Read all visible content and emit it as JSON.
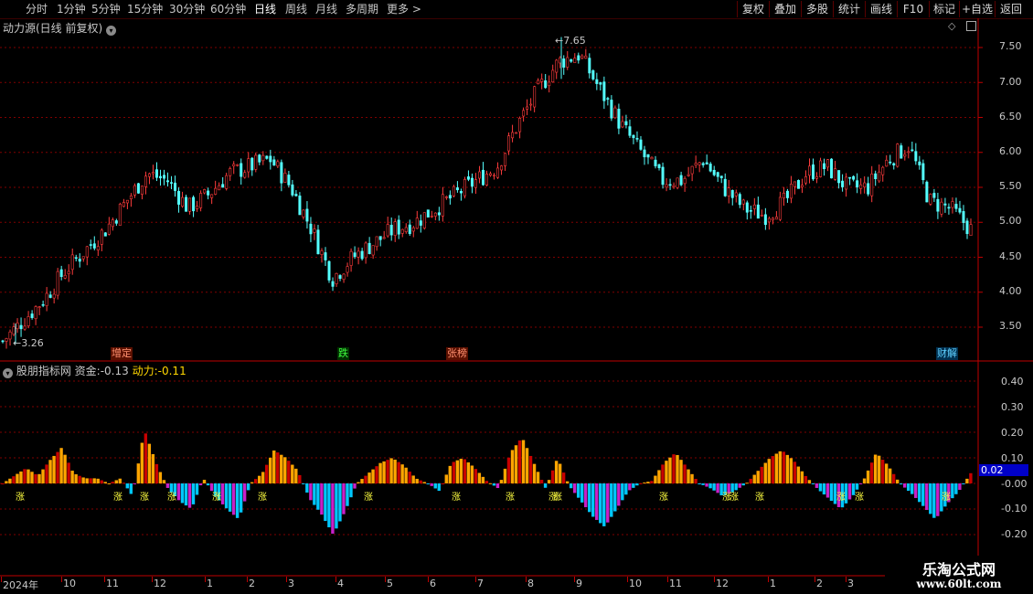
{
  "toolbar": {
    "periods": [
      "分时",
      "1分钟",
      "5分钟",
      "15分钟",
      "30分钟",
      "60分钟",
      "日线",
      "周线",
      "月线",
      "多周期",
      "更多 >"
    ],
    "active_period": "日线",
    "buttons": [
      "复权",
      "叠加",
      "多股",
      "统计",
      "画线",
      "F10",
      "标记",
      "+自选",
      "返回"
    ]
  },
  "main_panel": {
    "title": "动力源(日线 前复权)",
    "high_label": "7.65",
    "low_label": "3.26",
    "y_ticks": [
      "7.50",
      "7.00",
      "6.50",
      "6.00",
      "5.50",
      "5.00",
      "4.50",
      "4.00",
      "3.50"
    ],
    "events": [
      {
        "label": "增定",
        "color": "#ff7060"
      },
      {
        "label": "跌",
        "color": "#40ff40"
      },
      {
        "label": "张榜",
        "color": "#ff7060"
      },
      {
        "label": "财解",
        "color": "#60d0ff"
      }
    ]
  },
  "indicator_panel": {
    "name": "股朋指标网",
    "zijin_label": "资金:",
    "zijin_value": "-0.13",
    "dongli_label": "动力:",
    "dongli_value": "-0.11",
    "y_ticks": [
      "0.40",
      "0.30",
      "0.20",
      "0.10",
      "-0.00",
      "-0.10",
      "-0.20"
    ],
    "current_value_tag": "0.02",
    "signal_label": "涨"
  },
  "time_axis": {
    "labels": [
      "2024年",
      "10",
      "11",
      "12",
      "1",
      "2",
      "3",
      "4",
      "5",
      "6",
      "7",
      "8",
      "9",
      "10",
      "11",
      "12",
      "1",
      "2",
      "3"
    ]
  },
  "watermark": {
    "line1": "乐淘公式网",
    "line2": "www.60lt.com"
  },
  "colors": {
    "up": "#ff3c3c",
    "down": "#54ffff",
    "gridline": "#800000",
    "fund_pos_a": "#ffa500",
    "fund_pos_b": "#c80000",
    "fund_neg_a": "#00c8ff",
    "fund_neg_b": "#c820c8",
    "value_tag_bg": "#0000c8"
  },
  "chart_data": [
    {
      "type": "candlestick",
      "title": "动力源(日线 前复权)",
      "ylim": [
        3.2,
        7.8
      ],
      "y_ticks": [
        3.5,
        4.0,
        4.5,
        5.0,
        5.5,
        6.0,
        6.5,
        7.0,
        7.5
      ],
      "max": 7.65,
      "min": 3.26,
      "close_trend": [
        3.3,
        3.6,
        3.9,
        4.3,
        4.6,
        4.9,
        5.3,
        5.7,
        5.6,
        5.2,
        5.4,
        5.7,
        5.8,
        5.9,
        5.5,
        4.9,
        4.2,
        4.5,
        4.7,
        4.9,
        5.0,
        5.2,
        5.4,
        5.6,
        5.8,
        6.4,
        6.9,
        7.3,
        7.4,
        6.9,
        6.4,
        6.0,
        5.6,
        5.6,
        5.9,
        5.5,
        5.2,
        5.1,
        5.3,
        5.7,
        5.8,
        5.5,
        5.5,
        5.9,
        6.1,
        5.3,
        5.2,
        4.9
      ]
    },
    {
      "type": "bar",
      "title": "股朋指标网",
      "ylim": [
        -0.25,
        0.45
      ],
      "y_ticks": [
        0.4,
        0.3,
        0.2,
        0.1,
        0.0,
        -0.1,
        -0.2
      ],
      "series": [
        {
          "name": "资金",
          "last_value": -0.13
        },
        {
          "name": "动力",
          "last_value": -0.11
        }
      ],
      "values": [
        0.0,
        0.03,
        0.06,
        0.03,
        0.09,
        0.14,
        0.04,
        0.02,
        0.02,
        0.0,
        0.02,
        -0.05,
        0.21,
        0.08,
        -0.02,
        -0.07,
        -0.1,
        0.02,
        -0.05,
        -0.1,
        -0.14,
        0.0,
        0.04,
        0.13,
        0.1,
        0.05,
        -0.06,
        -0.12,
        -0.2,
        -0.11,
        0.0,
        0.04,
        0.08,
        0.1,
        0.07,
        0.02,
        0.0,
        -0.03,
        0.08,
        0.1,
        0.06,
        0.01,
        -0.02,
        0.12,
        0.18,
        0.08,
        -0.02,
        0.1,
        -0.01,
        -0.07,
        -0.13,
        -0.17,
        -0.1,
        -0.03,
        0.0,
        0.01,
        0.08,
        0.12,
        0.06,
        0.0,
        -0.02,
        -0.05,
        -0.03,
        0.0,
        0.05,
        0.1,
        0.13,
        0.09,
        0.03,
        -0.02,
        -0.06,
        -0.1,
        -0.05,
        0.02,
        0.12,
        0.07,
        0.0,
        -0.04,
        -0.09,
        -0.14,
        -0.08,
        -0.03,
        0.04
      ]
    }
  ]
}
